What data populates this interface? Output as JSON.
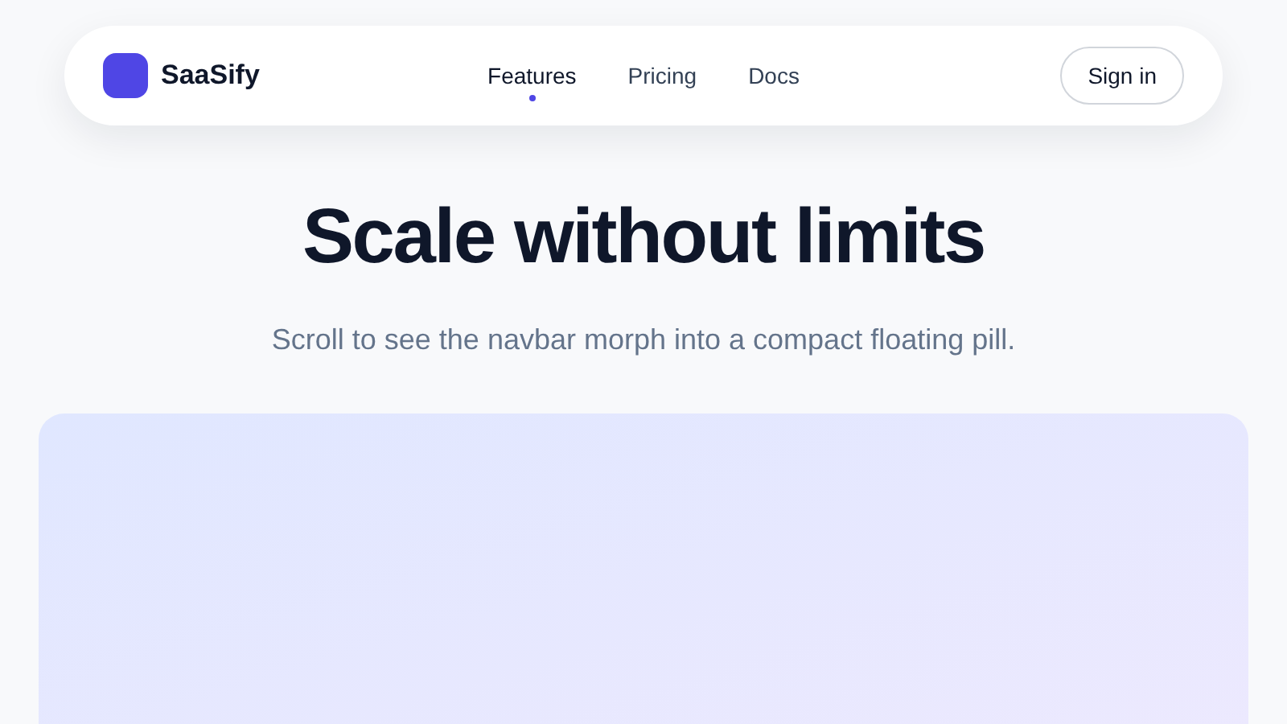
{
  "navbar": {
    "brand": "SaaSify",
    "links": [
      {
        "label": "Features",
        "selected": true
      },
      {
        "label": "Pricing",
        "selected": false
      },
      {
        "label": "Docs",
        "selected": false
      }
    ],
    "sign_in": "Sign in"
  },
  "hero": {
    "title": "Scale without limits",
    "subtitle": "Scroll to see the navbar morph into a compact floating pill."
  }
}
